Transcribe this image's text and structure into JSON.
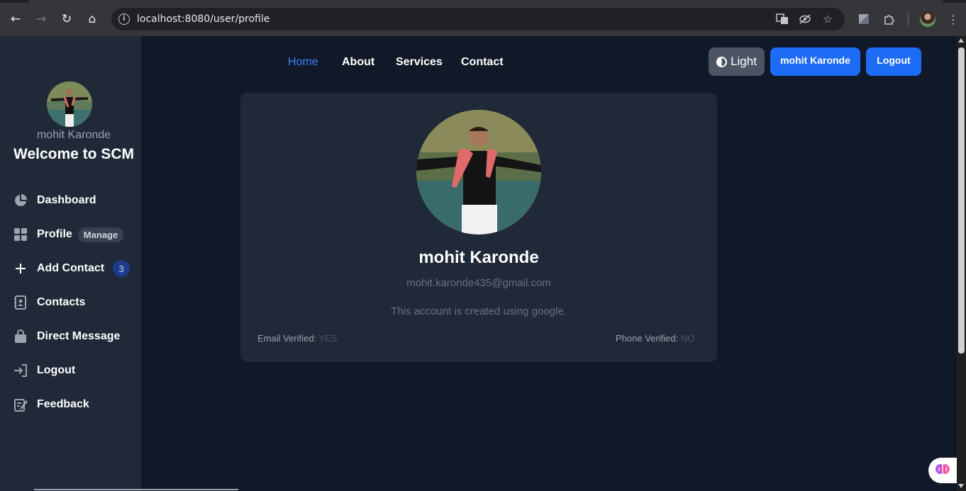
{
  "browser": {
    "url": "localhost:8080/user/profile"
  },
  "sidebar": {
    "user_name": "mohit Karonde",
    "welcome": "Welcome to SCM",
    "items": [
      {
        "label": "Dashboard",
        "icon": "pie-chart-icon"
      },
      {
        "label": "Profile",
        "icon": "grid-icon",
        "badge": "Manage"
      },
      {
        "label": "Add Contact",
        "icon": "plus-icon",
        "badge": "3"
      },
      {
        "label": "Contacts",
        "icon": "address-book-icon"
      },
      {
        "label": "Direct Message",
        "icon": "shopping-bag-icon"
      },
      {
        "label": "Logout",
        "icon": "sign-out-icon"
      },
      {
        "label": "Feedback",
        "icon": "edit-note-icon"
      }
    ]
  },
  "topnav": {
    "links": [
      "Home",
      "About",
      "Services",
      "Contact"
    ],
    "theme_label": "Light",
    "user_button": "mohit Karonde",
    "logout_button": "Logout"
  },
  "profile": {
    "name": "mohit Karonde",
    "email": "mohit.karonde435@gmail.com",
    "created_note": "This account is created using google.",
    "email_verified_label": "Email Verified:",
    "email_verified_value": "YES",
    "phone_verified_label": "Phone Verified:",
    "phone_verified_value": "NO"
  },
  "colors": {
    "page_bg": "#111827",
    "sidebar_bg": "#1f2937",
    "accent_blue": "#1d6cf5",
    "active_link": "#3b82f6"
  }
}
